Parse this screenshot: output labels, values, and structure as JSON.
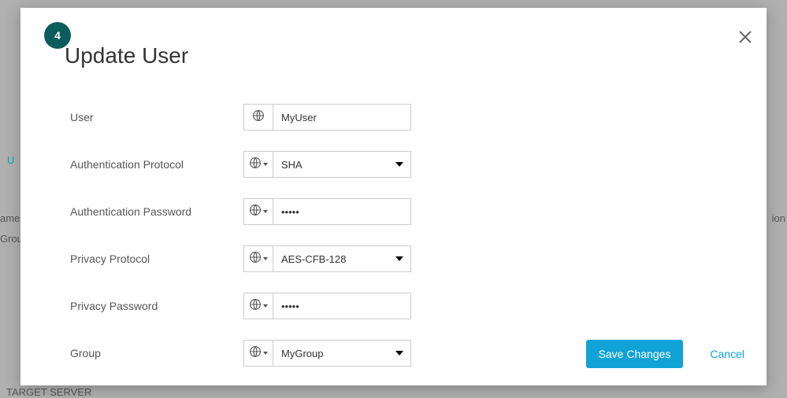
{
  "step_number": "4",
  "title": "Update User",
  "background": {
    "tab": "U",
    "col1": "ame",
    "col2": "Grou",
    "right": "ion",
    "footer": "TARGET SERVER"
  },
  "form": {
    "user": {
      "label": "User",
      "value": "MyUser"
    },
    "auth_proto": {
      "label": "Authentication Protocol",
      "value": "SHA"
    },
    "auth_pass": {
      "label": "Authentication Password",
      "value": "•••••"
    },
    "priv_proto": {
      "label": "Privacy Protocol",
      "value": "AES-CFB-128"
    },
    "priv_pass": {
      "label": "Privacy Password",
      "value": "•••••"
    },
    "group": {
      "label": "Group",
      "value": "MyGroup"
    }
  },
  "buttons": {
    "save": "Save Changes",
    "cancel": "Cancel"
  }
}
